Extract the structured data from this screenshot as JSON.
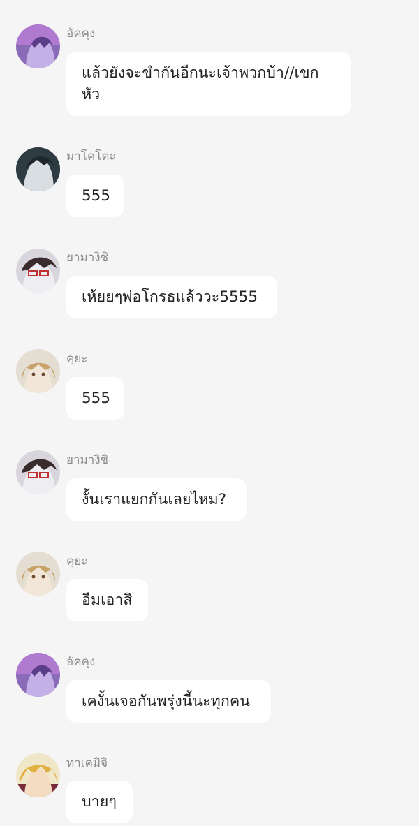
{
  "status_bar": {
    "time": "21:51",
    "left_icons": [
      "phone-icon",
      "person-icon",
      "dot-icon"
    ],
    "right_icons": [
      "wifi-icon",
      "signal-icon",
      "battery-icon"
    ]
  },
  "messages": [
    {
      "sender": "อัคคุง",
      "text": "แล้วยังจะขำกันอีกนะเจ้าพวกบ้า//เขกหัว",
      "avatar_color": "#7a5aa8"
    },
    {
      "sender": "มาโคโตะ",
      "text": "555",
      "avatar_color": "#3a4a52"
    },
    {
      "sender": "ยามางิชิ",
      "text": "เห้ยยๆพ่อโกรธแล้ววะ5555",
      "avatar_color": "#c9c6cc"
    },
    {
      "sender": "คุยะ",
      "text": "555",
      "avatar_color": "#cdb89c"
    },
    {
      "sender": "ยามางิชิ",
      "text": "งั้นเราแยกกันเลยไหม?",
      "avatar_color": "#c9c6cc"
    },
    {
      "sender": "คุยะ",
      "text": "อืมเอาสิ",
      "avatar_color": "#cdb89c"
    },
    {
      "sender": "อัคคุง",
      "text": "เคงั้นเจอกันพรุ่งนี้นะทุกคน",
      "avatar_color": "#7a5aa8"
    },
    {
      "sender": "ทาเคมิจิ",
      "text": "บายๆ",
      "avatar_color": "#e0b050"
    }
  ]
}
